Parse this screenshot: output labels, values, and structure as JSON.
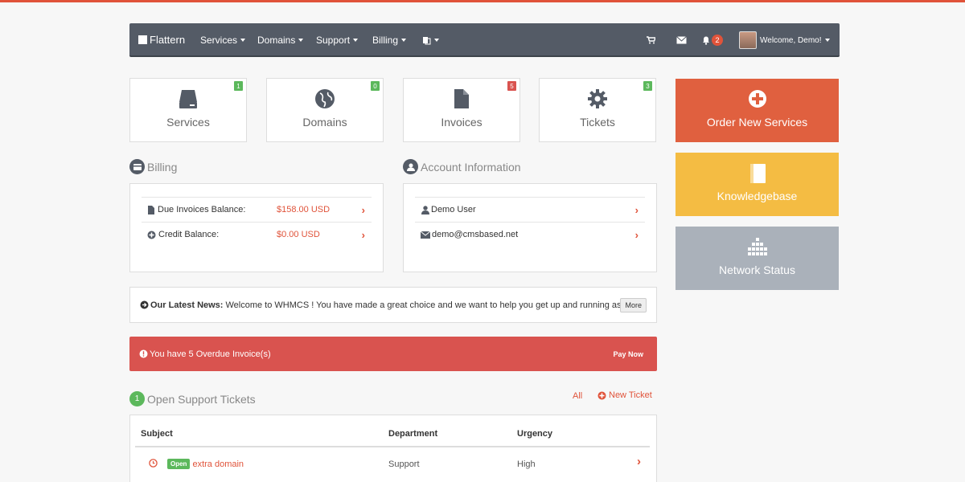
{
  "nav": {
    "brand": "Flattern",
    "items": [
      "Services",
      "Domains",
      "Support",
      "Billing"
    ],
    "notifications_count": "2",
    "welcome": "Welcome, Demo!"
  },
  "tiles": [
    {
      "label": "Services",
      "count": "1",
      "count_color": "#5cb85c",
      "icon": "server-icon"
    },
    {
      "label": "Domains",
      "count": "0",
      "count_color": "#5cb85c",
      "icon": "globe-icon"
    },
    {
      "label": "Invoices",
      "count": "5",
      "count_color": "#d9534f",
      "icon": "file-icon"
    },
    {
      "label": "Tickets",
      "count": "3",
      "count_color": "#5cb85c",
      "icon": "gear-icon"
    }
  ],
  "actions": [
    {
      "label": "Order New Services",
      "color": "#e0603f",
      "icon": "plus-circle-icon"
    },
    {
      "label": "Knowledgebase",
      "color": "#f4bc43",
      "icon": "book-icon"
    },
    {
      "label": "Network Status",
      "color": "#aab1ba",
      "icon": "network-icon"
    }
  ],
  "billing": {
    "title": "Billing",
    "rows": [
      {
        "label": "Due Invoices Balance:",
        "value": "$158.00 USD"
      },
      {
        "label": "Credit Balance:",
        "value": "$0.00 USD"
      }
    ]
  },
  "account": {
    "title": "Account Information",
    "name": "Demo User",
    "email": "demo@cmsbased.net"
  },
  "news": {
    "title": "Our Latest News:",
    "text": "Welcome to WHMCS ! You have made a great choice and we want to help you get up and running as...",
    "more": "More"
  },
  "alert": {
    "text": "You have 5 Overdue Invoice(s)",
    "action": "Pay Now"
  },
  "tickets": {
    "count": "1",
    "title": "Open Support Tickets",
    "all": "All",
    "new_ticket": "New Ticket",
    "columns": [
      "Subject",
      "Department",
      "Urgency"
    ],
    "rows": [
      {
        "status": "Open",
        "subject": "extra domain",
        "department": "Support",
        "urgency": "High"
      }
    ]
  },
  "colors": {
    "accent": "#e0533a",
    "navbar": "#545b66"
  }
}
